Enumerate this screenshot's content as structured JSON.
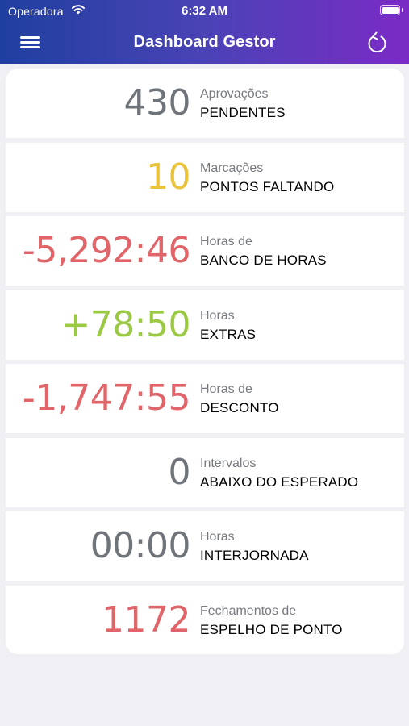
{
  "status_bar": {
    "carrier": "Operadora",
    "time": "6:32 AM"
  },
  "nav": {
    "title": "Dashboard Gestor",
    "menu_icon": "hamburger-menu-icon",
    "refresh_icon": "refresh-icon"
  },
  "colors": {
    "gray": "#6f747a",
    "yellow": "#e9c33b",
    "red": "#e06468",
    "green": "#9cc944"
  },
  "cards": [
    {
      "value": "430",
      "label_top": "Aprovações",
      "label_bottom": "PENDENTES",
      "color": "#6f747a"
    },
    {
      "value": "10",
      "label_top": "Marcações",
      "label_bottom": "PONTOS FALTANDO",
      "color": "#e9c33b"
    },
    {
      "value": "-5,292:46",
      "label_top": "Horas de",
      "label_bottom": "BANCO DE HORAS",
      "color": "#e06468"
    },
    {
      "value": "+78:50",
      "label_top": "Horas",
      "label_bottom": "EXTRAS",
      "color": "#9cc944"
    },
    {
      "value": "-1,747:55",
      "label_top": "Horas de",
      "label_bottom": "DESCONTO",
      "color": "#e06468"
    },
    {
      "value": "0",
      "label_top": "Intervalos",
      "label_bottom": "ABAIXO DO ESPERADO",
      "color": "#6f747a"
    },
    {
      "value": "00:00",
      "label_top": "Horas",
      "label_bottom": "INTERJORNADA",
      "color": "#6f747a"
    },
    {
      "value": "1172",
      "label_top": "Fechamentos de",
      "label_bottom": "ESPELHO DE PONTO",
      "color": "#e06468"
    }
  ]
}
